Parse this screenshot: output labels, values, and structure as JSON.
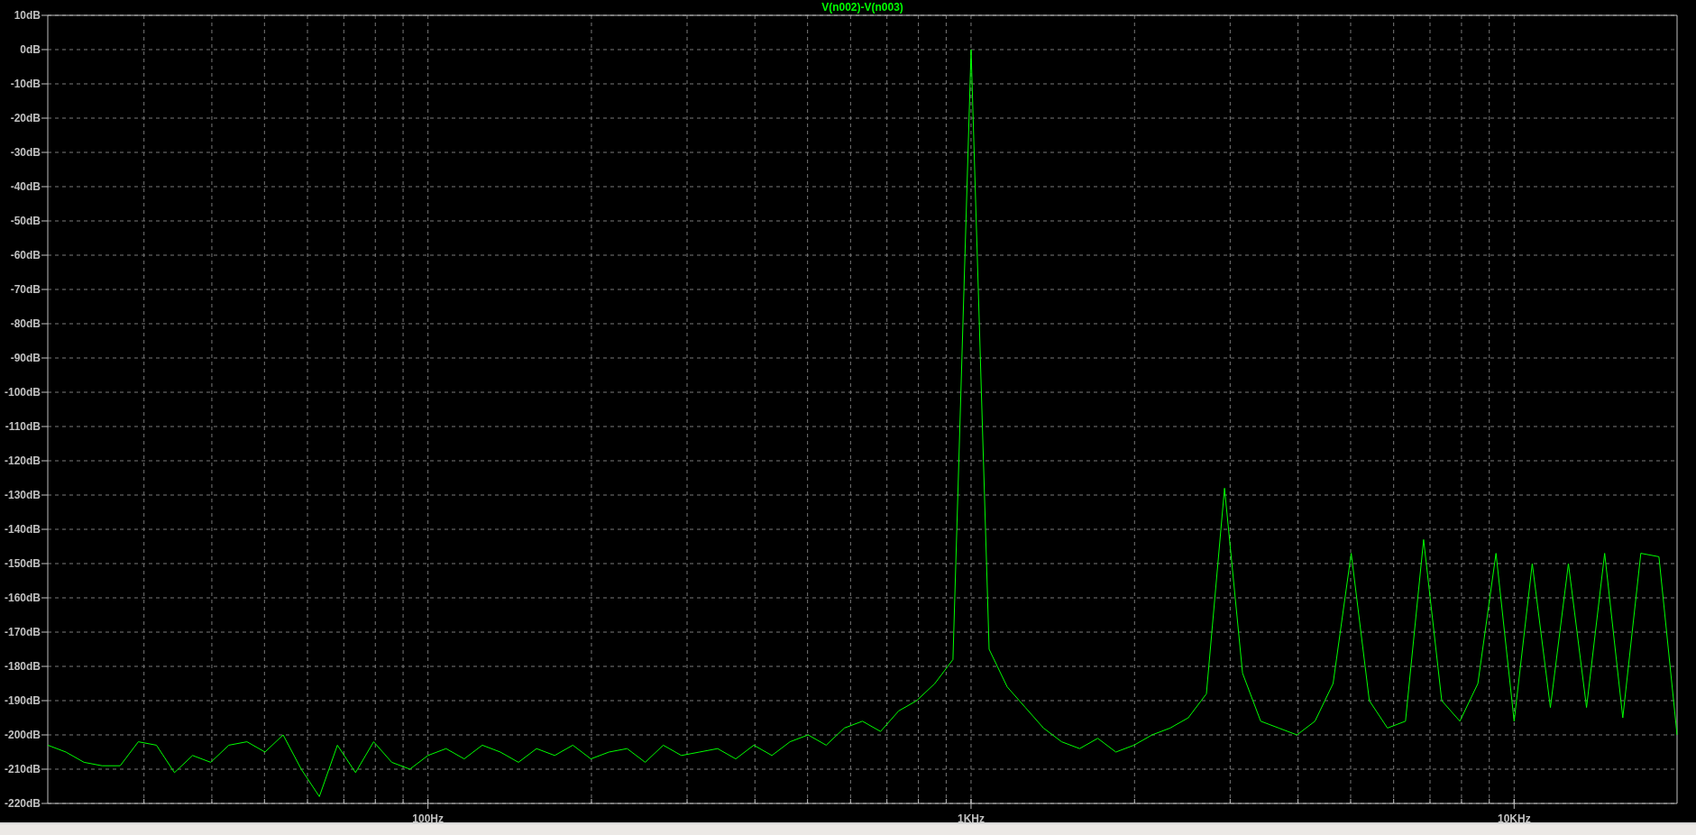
{
  "plot": {
    "chart_data": {
      "type": "line",
      "grid": true,
      "ylim": [
        -220,
        10
      ],
      "yticks": [
        {
          "value": 10,
          "label": "10dB"
        },
        {
          "value": 0,
          "label": "0dB"
        },
        {
          "value": -10,
          "label": "-10dB"
        },
        {
          "value": -20,
          "label": "-20dB"
        },
        {
          "value": -30,
          "label": "-30dB"
        },
        {
          "value": -40,
          "label": "-40dB"
        },
        {
          "value": -50,
          "label": "-50dB"
        },
        {
          "value": -60,
          "label": "-60dB"
        },
        {
          "value": -70,
          "label": "-70dB"
        },
        {
          "value": -80,
          "label": "-80dB"
        },
        {
          "value": -90,
          "label": "-90dB"
        },
        {
          "value": -100,
          "label": "-100dB"
        },
        {
          "value": -110,
          "label": "-110dB"
        },
        {
          "value": -120,
          "label": "-120dB"
        },
        {
          "value": -130,
          "label": "-130dB"
        },
        {
          "value": -140,
          "label": "-140dB"
        },
        {
          "value": -150,
          "label": "-150dB"
        },
        {
          "value": -160,
          "label": "-160dB"
        },
        {
          "value": -170,
          "label": "-170dB"
        },
        {
          "value": -180,
          "label": "-180dB"
        },
        {
          "value": -190,
          "label": "-190dB"
        },
        {
          "value": -200,
          "label": "-200dB"
        },
        {
          "value": -210,
          "label": "-210dB"
        },
        {
          "value": -220,
          "label": "-220dB"
        }
      ],
      "categories": [
        null,
        null,
        null,
        null,
        null,
        null,
        null,
        null,
        null,
        null,
        null,
        null,
        null,
        null,
        null,
        null,
        null,
        null,
        null,
        null,
        null,
        "100Hz",
        null,
        null,
        null,
        null,
        null,
        null,
        null,
        null,
        null,
        null,
        null,
        null,
        null,
        null,
        null,
        null,
        null,
        null,
        null,
        null,
        null,
        null,
        null,
        null,
        null,
        null,
        null,
        null,
        null,
        "1KHz",
        null,
        null,
        null,
        null,
        null,
        null,
        null,
        null,
        null,
        null,
        null,
        null,
        null,
        null,
        null,
        null,
        null,
        null,
        null,
        null,
        null,
        null,
        null,
        null,
        null,
        null,
        null,
        null,
        null,
        "10KHz",
        null,
        null,
        null,
        null,
        null,
        null,
        null,
        null,
        null
      ],
      "series": [
        {
          "name": "V(n002)-V(n003)",
          "color": "#00ff00",
          "values": [
            -203,
            -205,
            -208,
            -209,
            -209,
            -202,
            -203,
            -211,
            -206,
            -208,
            -203,
            -202,
            -205,
            -200,
            -210,
            -218,
            -203,
            -211,
            -202,
            -208,
            -210,
            -206,
            -204,
            -207,
            -203,
            -205,
            -208,
            -204,
            -206,
            -203,
            -207,
            -205,
            -204,
            -208,
            -203,
            -206,
            -205,
            -204,
            -207,
            -203,
            -206,
            -202,
            -200,
            -203,
            -198,
            -196,
            -199,
            -193,
            -190,
            -185,
            -178,
            0,
            -175,
            -186,
            -192,
            -198,
            -202,
            -204,
            -201,
            -205,
            -203,
            -200,
            -198,
            -195,
            -188,
            -128,
            -182,
            -196,
            -198,
            -200,
            -196,
            -185,
            -147,
            -190,
            -198,
            -196,
            -143,
            -190,
            -196,
            -185,
            -147,
            -196,
            -150,
            -192,
            -150,
            -192,
            -147,
            -195,
            -147,
            -148,
            -200
          ]
        }
      ]
    }
  }
}
